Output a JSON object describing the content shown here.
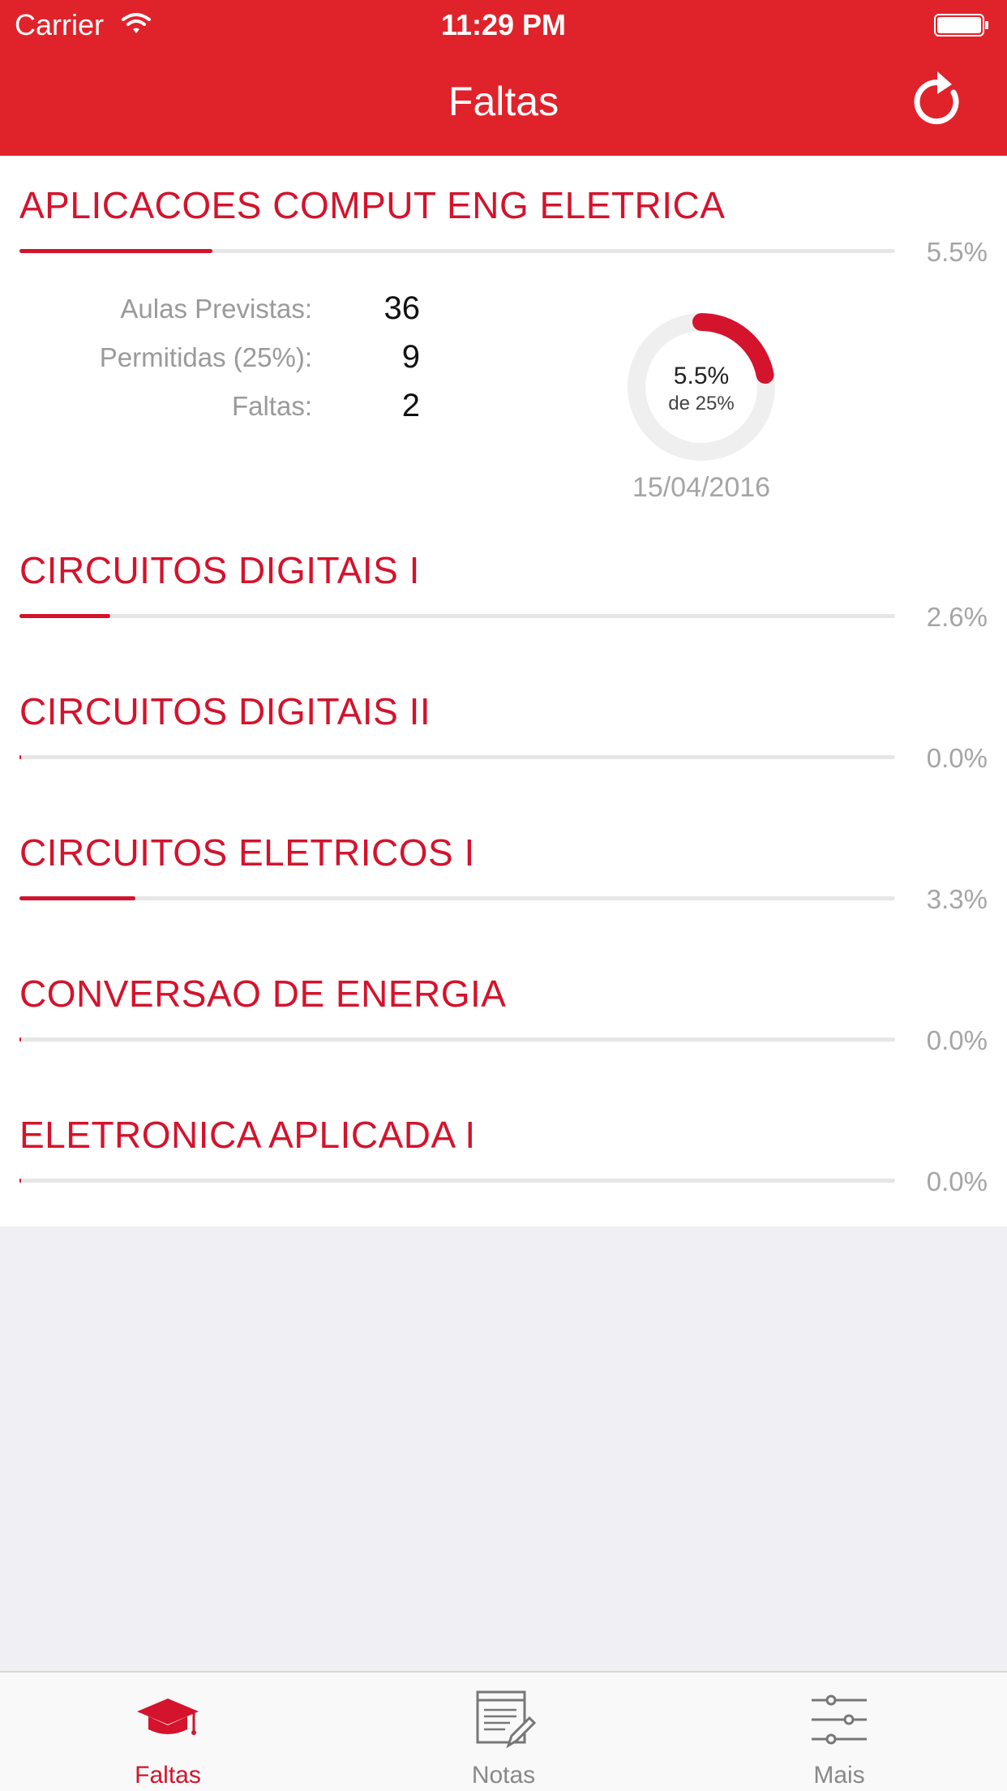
{
  "status_bar": {
    "carrier": "Carrier",
    "time": "11:29 PM"
  },
  "nav": {
    "title": "Faltas"
  },
  "colors": {
    "accent": "#e0232b",
    "subject_text": "#d4132c",
    "track": "#e6e6e6",
    "muted_text": "#a5a5a5"
  },
  "subjects": [
    {
      "name": "APLICACOES COMPUT ENG ELETRICA",
      "percent_label": "5.5%",
      "percent": 5.5,
      "details": {
        "planned_label": "Aulas Previstas:",
        "planned_value": "36",
        "allowed_label": "Permitidas (25%):",
        "allowed_value": "9",
        "absences_label": "Faltas:",
        "absences_value": "2",
        "donut_percent": "5.5%",
        "donut_sub": "de 25%",
        "donut_fraction": 0.22,
        "date": "15/04/2016"
      }
    },
    {
      "name": "CIRCUITOS DIGITAIS I",
      "percent_label": "2.6%",
      "percent": 2.6
    },
    {
      "name": "CIRCUITOS DIGITAIS II",
      "percent_label": "0.0%",
      "percent": 0.0
    },
    {
      "name": "CIRCUITOS ELETRICOS I",
      "percent_label": "3.3%",
      "percent": 3.3
    },
    {
      "name": "CONVERSAO DE ENERGIA",
      "percent_label": "0.0%",
      "percent": 0.0
    },
    {
      "name": "ELETRONICA APLICADA I",
      "percent_label": "0.0%",
      "percent": 0.0
    }
  ],
  "tabs": [
    {
      "label": "Faltas",
      "icon": "graduation-cap-icon",
      "active": true
    },
    {
      "label": "Notas",
      "icon": "notes-edit-icon",
      "active": false
    },
    {
      "label": "Mais",
      "icon": "sliders-icon",
      "active": false
    }
  ]
}
